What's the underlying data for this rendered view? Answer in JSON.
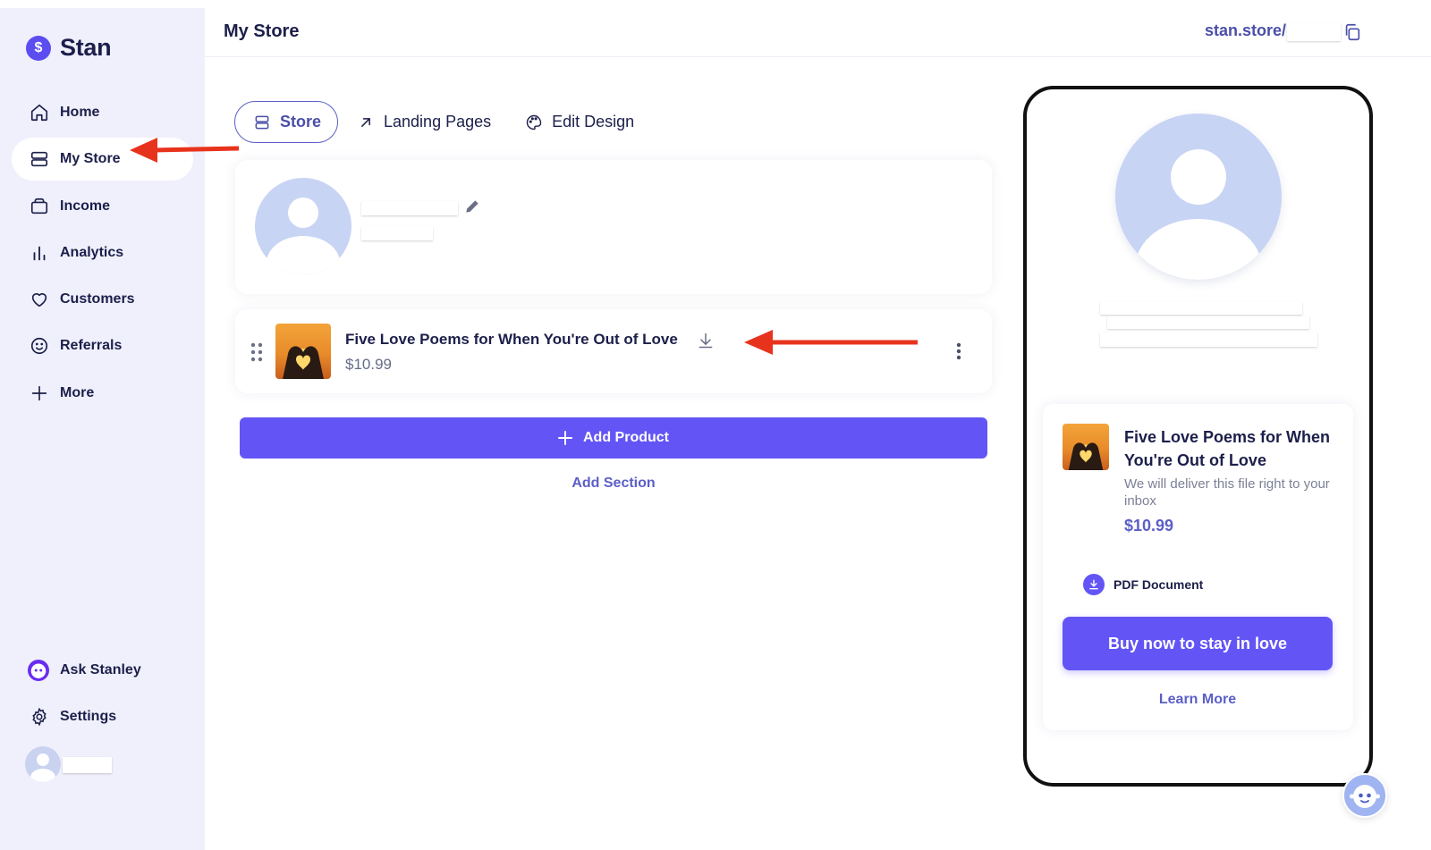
{
  "brand": {
    "name": "Stan",
    "logo_glyph": "$",
    "accent_color": "#6355f5"
  },
  "sidebar": {
    "items": [
      {
        "label": "Home",
        "icon": "home-icon"
      },
      {
        "label": "My Store",
        "icon": "store-icon",
        "active": true
      },
      {
        "label": "Income",
        "icon": "wallet-icon"
      },
      {
        "label": "Analytics",
        "icon": "bar-chart-icon"
      },
      {
        "label": "Customers",
        "icon": "heart-icon"
      },
      {
        "label": "Referrals",
        "icon": "smiley-icon"
      },
      {
        "label": "More",
        "icon": "plus-icon"
      }
    ],
    "bottom_items": [
      {
        "label": "Ask Stanley",
        "icon": "stanley-bot-icon"
      },
      {
        "label": "Settings",
        "icon": "gear-icon"
      }
    ]
  },
  "header": {
    "title": "My Store",
    "store_url": "stan.store/"
  },
  "tabs": [
    {
      "label": "Store",
      "icon": "sections-icon",
      "active": true
    },
    {
      "label": "Landing Pages",
      "icon": "arrow-up-right-icon"
    },
    {
      "label": "Edit Design",
      "icon": "palette-icon"
    }
  ],
  "product": {
    "title": "Five Love Poems for When You're Out of Love",
    "price": "$10.99"
  },
  "actions": {
    "add_product": "Add Product",
    "add_section": "Add Section"
  },
  "preview": {
    "product_title": "Five Love Poems for When You're Out of Love",
    "description": "We will deliver this file right to your inbox",
    "price": "$10.99",
    "file_type": "PDF Document",
    "buy_button": "Buy now to stay in love",
    "learn_more": "Learn More"
  }
}
